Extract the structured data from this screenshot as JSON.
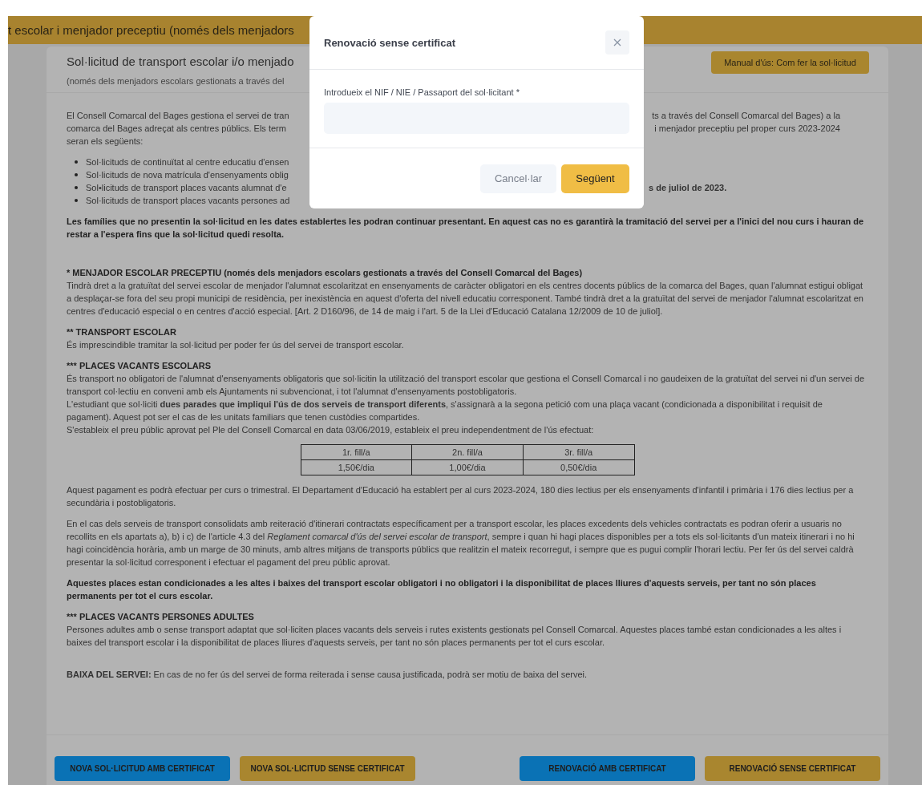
{
  "banner": {
    "title": "t escolar i menjador preceptiu (només dels menjadors"
  },
  "card": {
    "title": "Sol·licitud de transport escolar i/o menjado",
    "subtitle": "(només dels menjadors escolars gestionats a través del",
    "manual_button": "Manual d'ús: Com fer la sol·licitud"
  },
  "intro_lines": [
    {
      "left": "El Consell Comarcal del Bages gestiona el servei de tran",
      "right": "ts a través del Consell Comarcal del Bages) a la"
    },
    {
      "left": "comarca del Bages adreçat als centres públics. Els term",
      "right": "i menjador preceptiu pel proper curs 2023-2024"
    },
    {
      "left": "seran els següents:"
    }
  ],
  "bullets": [
    {
      "left": "Sol·licituds de continuïtat al centre educatiu d'ensen"
    },
    {
      "left": "Sol·licituds de nova matrícula d'ensenyaments oblig"
    },
    {
      "left": "Sol•licituds de transport places vacants alumnat d'e",
      "right": "s de juliol de 2023."
    },
    {
      "left": "Sol·licituds de transport places vacants persones ad"
    }
  ],
  "blocks": [
    {
      "kind": "bold",
      "text": "Les famílies que no presentin la sol·licitud en les dates establertes les podran continuar presentant. En aquest cas no es garantirà la tramitació del servei per a l'inici del nou curs i hauran de restar a l'espera fins que la sol·licitud quedi resolta."
    },
    {
      "kind": "section",
      "heading": "* MENJADOR ESCOLAR PRECEPTIU (només dels menjadors escolars gestionats a través del Consell Comarcal del Bages)",
      "lines": [
        "Tindrà dret a la gratuïtat del servei escolar de menjador l'alumnat escolaritzat en ensenyaments de caràcter obligatori en els centres docents públics de la comarca del Bages, quan l'alumnat estigui obligat a desplaçar-se fora del seu propi municipi de residència, per inexistència en aquest d'oferta del nivell educatiu corresponent. També tindrà dret a la gratuïtat del servei de menjador l'alumnat escolaritzat en centres d'educació especial o en centres d'acció especial. [Art. 2 D160/96, de 14 de maig i l'art. 5 de la Llei d'Educació Catalana 12/2009 de 10 de juliol]."
      ]
    },
    {
      "kind": "section",
      "heading": "** TRANSPORT ESCOLAR",
      "lines": [
        "És imprescindible tramitar la sol·licitud per poder fer ús del servei de transport escolar."
      ]
    },
    {
      "kind": "section",
      "heading": "*** PLACES VACANTS ESCOLARS",
      "lines": [
        "És transport no obligatori de l'alumnat d'ensenyaments obligatoris que sol·licitin la utilització del transport escolar que gestiona el Consell Comarcal i no gaudeixen de la gratuïtat del servei ni d'un servei de transport col·lectiu en conveni amb els Ajuntaments ni subvencionat, i tot l'alumnat d'ensenyaments postobligatoris.",
        "L'estudiant que sol·liciti **dues parades que impliqui l'ús de dos serveis de transport diferents**, s'assignarà a la segona petició com una plaça vacant (condicionada a disponibilitat i requisit de pagament). Aquest pot ser el cas de les unitats familiars que tenen custòdies compartides.",
        "S'estableix el preu públic aprovat pel Ple del Consell Comarcal en data 03/06/2019, estableix el preu independentment de l'ús efectuat:"
      ]
    },
    {
      "kind": "table",
      "header": [
        "1r. fill/a",
        "2n. fill/a",
        "3r. fill/a"
      ],
      "rows": [
        [
          "1,50€/dia",
          "1,00€/dia",
          "0,50€/dia"
        ]
      ]
    },
    {
      "kind": "p",
      "text": "Aquest pagament es podrà efectuar per curs o trimestral. El Departament d'Educació ha establert per al curs 2023-2024, 180 dies lectius per els ensenyaments d'infantil i primària i 176 dies lectius per a secundària i postobligatoris."
    },
    {
      "kind": "p",
      "text": "En el cas dels serveis de transport consolidats amb reiteració d'itinerari contractats específicament per a transport escolar, les places excedents dels vehicles contractats es podran oferir a usuaris no recollits en els apartats a), b) i c) de l'article 4.3 del *Reglament comarcal d'ús del servei escolar de transport*, sempre i quan hi hagi places disponibles per a tots els sol·licitants d'un mateix itinerari i no hi hagi coincidència horària, amb un marge de 30 minuts, amb altres mitjans de transports públics que realitzin el mateix recorregut, i sempre que es pugui complir l'horari lectiu. Per fer ús del servei caldrà presentar la sol·licitud corresponent i efectuar el pagament del preu públic aprovat."
    },
    {
      "kind": "bold",
      "text": "Aquestes places estan condicionades a les altes i baixes del transport escolar obligatori i no obligatori i la disponibilitat de places lliures d'aquests serveis, per tant no són places permanents per tot el curs escolar."
    },
    {
      "kind": "section",
      "heading": "*** PLACES VACANTS PERSONES ADULTES",
      "lines": [
        "Persones adultes amb o sense transport adaptat que sol·liciten places vacants dels serveis i rutes existents gestionats pel Consell Comarcal. Aquestes places també estan condicionades a les altes i baixes del transport escolar i la disponibilitat de places lliures d'aquests serveis, per tant no són places permanents per tot el curs escolar."
      ]
    },
    {
      "kind": "p",
      "text": "**BAIXA DEL SERVEI:** En cas de no fer ús del servei de forma reiterada i sense causa justificada, podrà ser motiu de baixa del servei."
    }
  ],
  "footer": {
    "left_buttons": [
      {
        "label": "NOVA SOL·LICITUD AMB CERTIFICAT",
        "color": "#0a72b5"
      },
      {
        "label": "NOVA SOL·LICITUD SENSE CERTIFICAT",
        "color": "#a9862f"
      }
    ],
    "right_buttons": [
      {
        "label": "RENOVACIÓ AMB CERTIFICAT",
        "color": "#0a72b5"
      },
      {
        "label": "RENOVACIÓ SENSE CERTIFICAT",
        "color": "#a9862f"
      }
    ]
  },
  "modal": {
    "title": "Renovació sense certificat",
    "field_label": "Introdueix el NIF / NIE / Passaport del sol·licitant *",
    "buttons": [
      {
        "label": "Cancel·lar",
        "kind": "secondary"
      },
      {
        "label": "Següent",
        "kind": "primary"
      }
    ]
  }
}
